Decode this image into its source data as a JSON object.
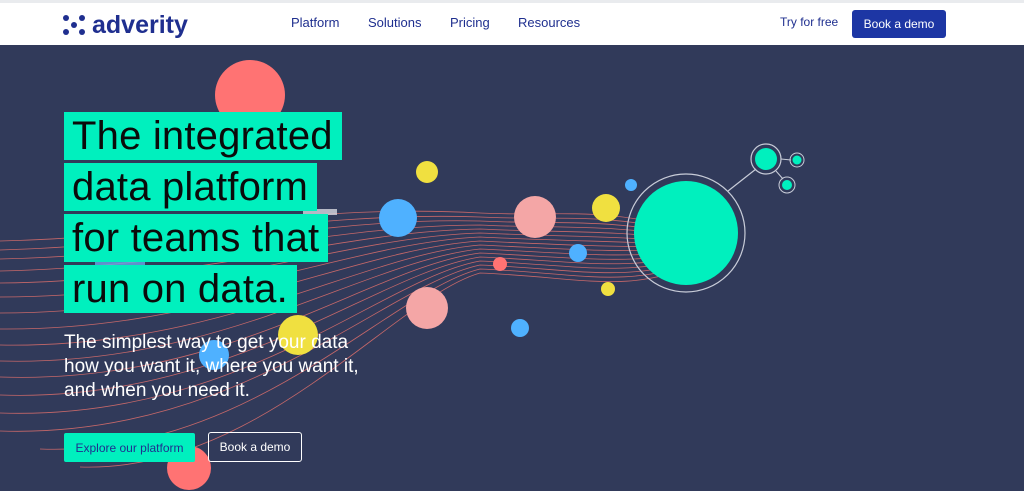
{
  "brand": {
    "name": "adverity",
    "logo_icon": "adverity-logo-icon"
  },
  "nav": {
    "items": [
      {
        "label": "Platform"
      },
      {
        "label": "Solutions"
      },
      {
        "label": "Pricing"
      },
      {
        "label": "Resources"
      }
    ],
    "try_free_label": "Try for free",
    "book_demo_label": "Book a demo"
  },
  "hero": {
    "headline_lines": [
      "The integrated",
      "data platform",
      "for teams that",
      "run on data."
    ],
    "subheadline_lines": [
      "The simplest way to get your data",
      "how you want it, where you want it,",
      "and when you need it."
    ],
    "primary_cta_label": "Explore our platform",
    "secondary_cta_label": "Book a demo"
  },
  "colors": {
    "navy": "#1f2f8f",
    "button_blue": "#1d36a4",
    "hero_bg": "#313a5a",
    "accent_teal": "#00f0be",
    "coral": "#ff7373",
    "pink": "#f4a6a6",
    "yellow": "#f0e040",
    "blue": "#4fb1ff"
  }
}
